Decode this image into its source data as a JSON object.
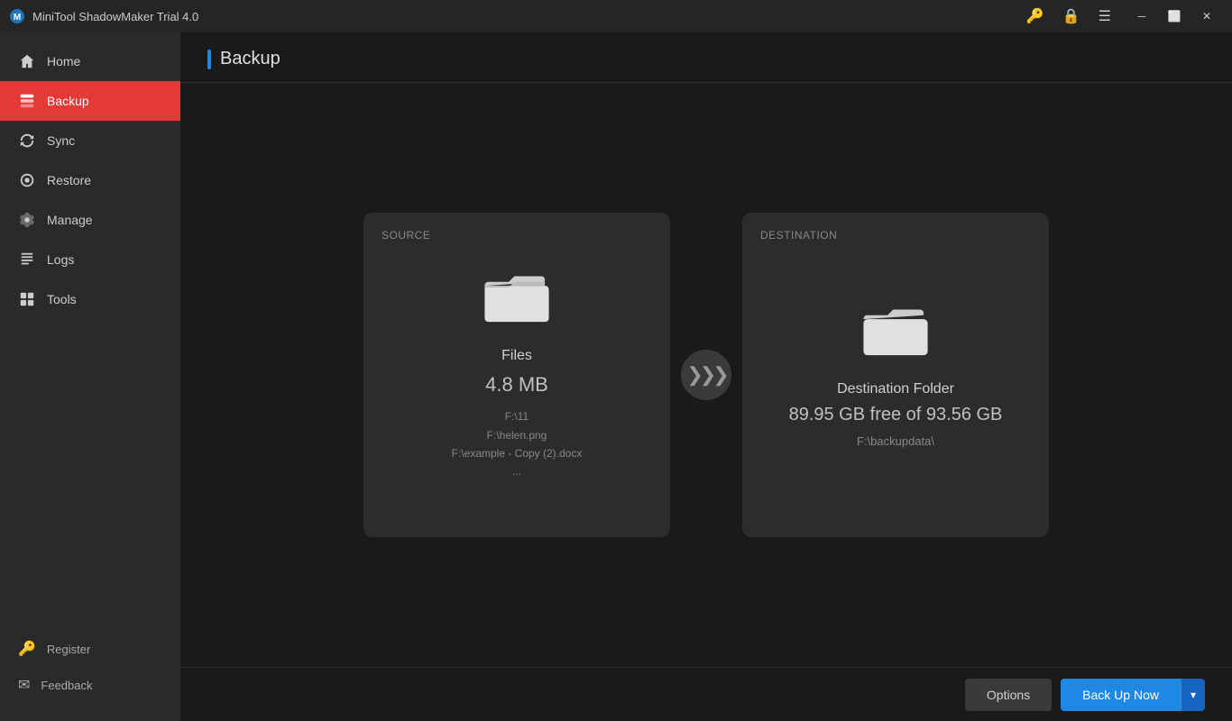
{
  "titlebar": {
    "title": "MiniTool ShadowMaker Trial 4.0",
    "logo_symbol": "🛡"
  },
  "sidebar": {
    "nav_items": [
      {
        "id": "home",
        "label": "Home",
        "icon": "home",
        "active": false
      },
      {
        "id": "backup",
        "label": "Backup",
        "icon": "backup",
        "active": true
      },
      {
        "id": "sync",
        "label": "Sync",
        "icon": "sync",
        "active": false
      },
      {
        "id": "restore",
        "label": "Restore",
        "icon": "restore",
        "active": false
      },
      {
        "id": "manage",
        "label": "Manage",
        "icon": "manage",
        "active": false
      },
      {
        "id": "logs",
        "label": "Logs",
        "icon": "logs",
        "active": false
      },
      {
        "id": "tools",
        "label": "Tools",
        "icon": "tools",
        "active": false
      }
    ],
    "bottom_items": [
      {
        "id": "register",
        "label": "Register",
        "icon": "key"
      },
      {
        "id": "feedback",
        "label": "Feedback",
        "icon": "mail"
      }
    ]
  },
  "page": {
    "title": "Backup"
  },
  "source_card": {
    "label": "SOURCE",
    "type_label": "Files",
    "size": "4.8 MB",
    "files": [
      "F:\\11",
      "F:\\helen.png",
      "F:\\example - Copy (2).docx",
      "..."
    ]
  },
  "destination_card": {
    "label": "DESTINATION",
    "type_label": "Destination Folder",
    "free_size": "89.95 GB free of 93.56 GB",
    "path": "F:\\backupdata\\"
  },
  "footer": {
    "options_label": "Options",
    "backup_now_label": "Back Up Now",
    "dropdown_symbol": "▾"
  },
  "colors": {
    "accent_blue": "#1e88e5",
    "active_nav": "#e53935"
  }
}
